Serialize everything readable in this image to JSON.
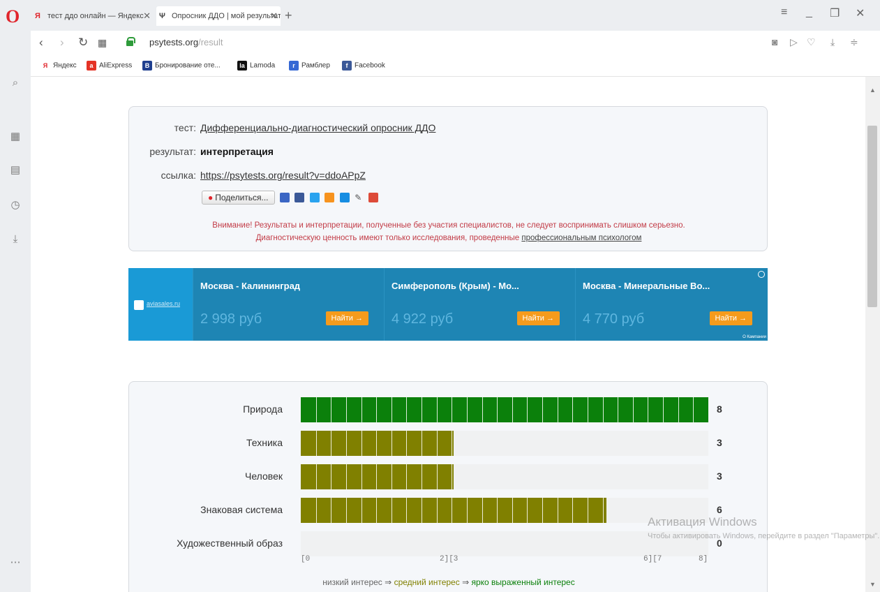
{
  "browser": {
    "tabs": [
      {
        "title": "тест ддо онлайн — Яндекс",
        "favicon": "yandex-icon"
      },
      {
        "title": "Опросник ДДО | мой результат",
        "favicon": "psi-icon"
      }
    ],
    "url_domain": "psytests.org",
    "url_path": "/result",
    "bookmarks": [
      "Яндекс",
      "AliExpress",
      "Бронирование оте...",
      "Lamoda",
      "Рамблер",
      "Facebook"
    ]
  },
  "result": {
    "test_label": "тест:",
    "test_name": "Дифференциально-диагностический опросник ДДО",
    "result_label": "результат:",
    "result_value": "интерпретация",
    "link_label": "ссылка:",
    "link_url": "https://psytests.org/result?v=ddoAPpZ",
    "share_label": "Поделиться...",
    "warning_1": "Внимание! Результаты и интерпретации, полученные без участия специалистов, не следует воспринимать слишком серьезно.",
    "warning_2_prefix": "Диагностическую ценность имеют только исследования, проведенные ",
    "warning_2_link": "профессиональным психологом"
  },
  "ad": {
    "brand": "aviasales.ru",
    "offers": [
      {
        "route": "Москва - Калининград",
        "price": "2 998 руб",
        "button": "Найти →"
      },
      {
        "route": "Симферополь (Крым) - Мо...",
        "price": "4 922 руб",
        "button": "Найти →"
      },
      {
        "route": "Москва - Минеральные Во...",
        "price": "4 770 руб",
        "button": "Найти →"
      }
    ],
    "corner_text": "О Кампании"
  },
  "chart_data": {
    "type": "bar",
    "orientation": "horizontal",
    "categories": [
      "Природа",
      "Техника",
      "Человек",
      "Знаковая система",
      "Художественный образ"
    ],
    "values": [
      8,
      3,
      3,
      6,
      0
    ],
    "value_labels": [
      "8",
      "3",
      "3",
      "6",
      "0"
    ],
    "xlim": [
      0,
      8
    ],
    "bar_colors": [
      "#0b800b",
      "#808000",
      "#808000",
      "#808000",
      "#808000"
    ],
    "range_ticks": [
      {
        "text": "[0",
        "value": 0
      },
      {
        "text": "2][3",
        "value": 3
      },
      {
        "text": "6][7",
        "value": 7
      },
      {
        "text": "8]",
        "value": 8
      }
    ],
    "legend": {
      "low": "низкий интерес",
      "arrow": "⇒",
      "medium": "средний интерес",
      "high": "ярко выраженный интерес",
      "low_color": "#666666",
      "medium_color": "#808000",
      "high_color": "#0b800b"
    }
  },
  "watermark": {
    "title": "Активация Windows",
    "subtitle": "Чтобы активировать Windows, перейдите в раздел \"Параметры\"."
  }
}
